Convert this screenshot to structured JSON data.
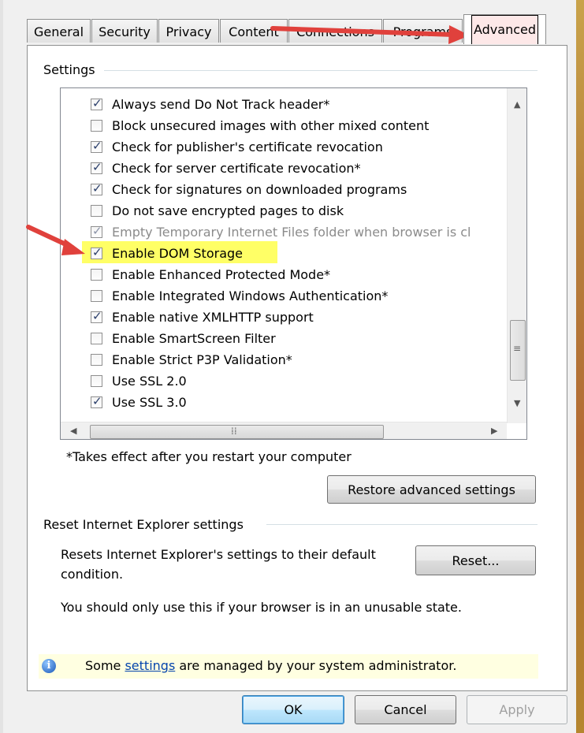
{
  "tabs": [
    {
      "label": "General"
    },
    {
      "label": "Security"
    },
    {
      "label": "Privacy"
    },
    {
      "label": "Content"
    },
    {
      "label": "Connections"
    },
    {
      "label": "Programs"
    },
    {
      "label": "Advanced",
      "active": true
    }
  ],
  "settings_group": {
    "label": "Settings",
    "items": [
      {
        "label": "Always send Do Not Track header*",
        "checked": true
      },
      {
        "label": "Block unsecured images with other mixed content",
        "checked": false
      },
      {
        "label": "Check for publisher's certificate revocation",
        "checked": true
      },
      {
        "label": "Check for server certificate revocation*",
        "checked": true
      },
      {
        "label": "Check for signatures on downloaded programs",
        "checked": true
      },
      {
        "label": "Do not save encrypted pages to disk",
        "checked": false
      },
      {
        "label": "Empty Temporary Internet Files folder when browser is cl",
        "checked": true,
        "dimmed": true
      },
      {
        "label": "Enable DOM Storage",
        "checked": true,
        "highlighted": true
      },
      {
        "label": "Enable Enhanced Protected Mode*",
        "checked": false
      },
      {
        "label": "Enable Integrated Windows Authentication*",
        "checked": false
      },
      {
        "label": "Enable native XMLHTTP support",
        "checked": true
      },
      {
        "label": "Enable SmartScreen Filter",
        "checked": false
      },
      {
        "label": "Enable Strict P3P Validation*",
        "checked": false
      },
      {
        "label": "Use SSL 2.0",
        "checked": false
      },
      {
        "label": "Use SSL 3.0",
        "checked": true
      }
    ],
    "note": "*Takes effect after you restart your computer",
    "restore_button": "Restore advanced settings"
  },
  "reset_group": {
    "label": "Reset Internet Explorer settings",
    "description": "Resets Internet Explorer's settings to their default condition.",
    "description_line1": "Resets Internet Explorer's settings to their default",
    "description_line2": "condition.",
    "reset_button": "Reset...",
    "warning": "You should only use this if your browser is in an unusable state."
  },
  "info_bar": {
    "prefix": "Some ",
    "link": "settings",
    "suffix": " are managed by your system administrator."
  },
  "footer": {
    "ok": "OK",
    "cancel": "Cancel",
    "apply": "Apply"
  },
  "colors": {
    "highlight": "#ffff66",
    "annotation_arrow": "#e0413c",
    "info_bar": "#ffffe1"
  },
  "icons": {
    "checkbox_mark": "check-icon",
    "info": "info-icon"
  }
}
